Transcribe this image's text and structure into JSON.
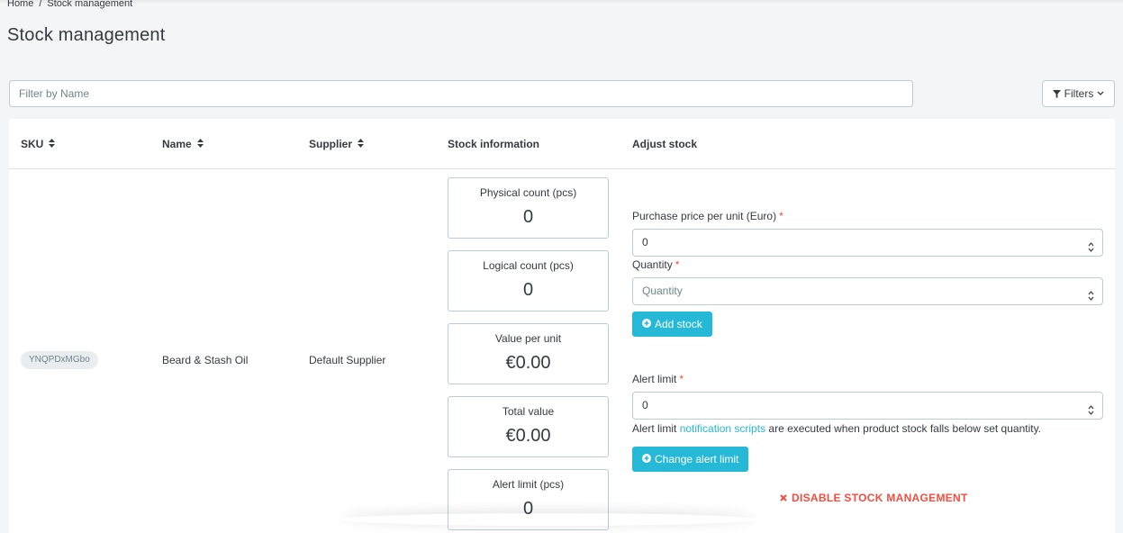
{
  "breadcrumb": {
    "home": "Home",
    "separator": "/",
    "current": "Stock management"
  },
  "page": {
    "title": "Stock management"
  },
  "filter": {
    "placeholder": "Filter by Name",
    "filters_button": "Filters"
  },
  "table": {
    "headers": {
      "sku": "SKU",
      "name": "Name",
      "supplier": "Supplier",
      "stock_info": "Stock information",
      "adjust": "Adjust stock"
    },
    "row": {
      "sku": "YNQPDxMGbo",
      "name": "Beard & Stash Oil",
      "supplier": "Default Supplier",
      "stats": [
        {
          "label": "Physical count (pcs)",
          "value": "0"
        },
        {
          "label": "Logical count (pcs)",
          "value": "0"
        },
        {
          "label": "Value per unit",
          "value": "€0.00"
        },
        {
          "label": "Total value",
          "value": "€0.00"
        },
        {
          "label": "Alert limit (pcs)",
          "value": "0"
        }
      ],
      "adjust": {
        "price_label": "Purchase price per unit (Euro)",
        "price_value": "0",
        "quantity_label": "Quantity",
        "quantity_placeholder": "Quantity",
        "add_stock_button": "Add stock",
        "alert_label": "Alert limit",
        "alert_value": "0",
        "required_marker": "*",
        "help_prefix": "Alert limit",
        "help_link": "notification scripts",
        "help_suffix": "are executed when product stock falls below set quantity.",
        "change_alert_button": "Change alert limit",
        "disable_link": "DISABLE STOCK MANAGEMENT"
      }
    }
  },
  "colors": {
    "accent": "#25b9d7",
    "danger": "#f54c3e",
    "border": "#bbcdd2",
    "text": "#363a41",
    "muted": "#6c868e"
  },
  "icons": [
    "filter-icon",
    "chevron-down-icon",
    "sort-icon",
    "spinner-icon",
    "plus-circle-icon",
    "close-icon"
  ]
}
